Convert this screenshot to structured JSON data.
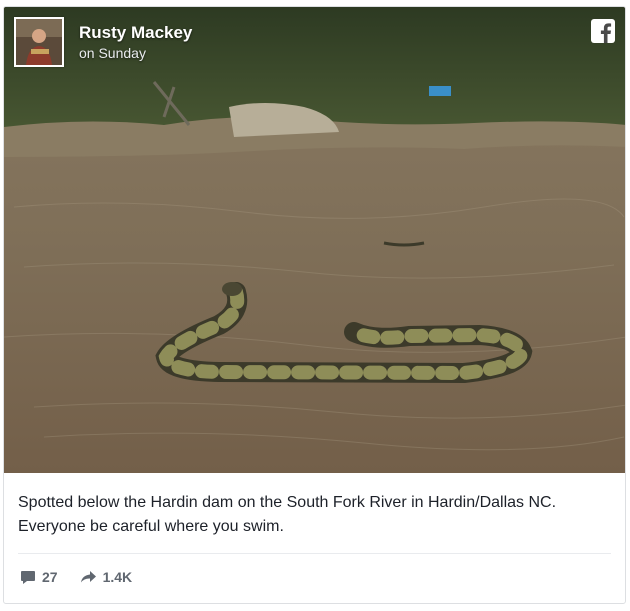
{
  "post": {
    "author": "Rusty Mackey",
    "timestamp": "on Sunday",
    "caption": "Spotted below the Hardin dam on the South Fork River in Hardin/Dallas NC. Everyone be careful where you swim.",
    "photo_icon": "river-snake-photo",
    "avatar_icon": "profile-photo"
  },
  "brand": {
    "icon": "facebook-icon",
    "color": "#ffffff"
  },
  "stats": {
    "comments": {
      "icon": "comment-icon",
      "count": "27"
    },
    "shares": {
      "icon": "share-icon",
      "count": "1.4K"
    }
  },
  "colors": {
    "text": "#1d2129",
    "muted": "#606770",
    "border": "#dddfe2"
  }
}
